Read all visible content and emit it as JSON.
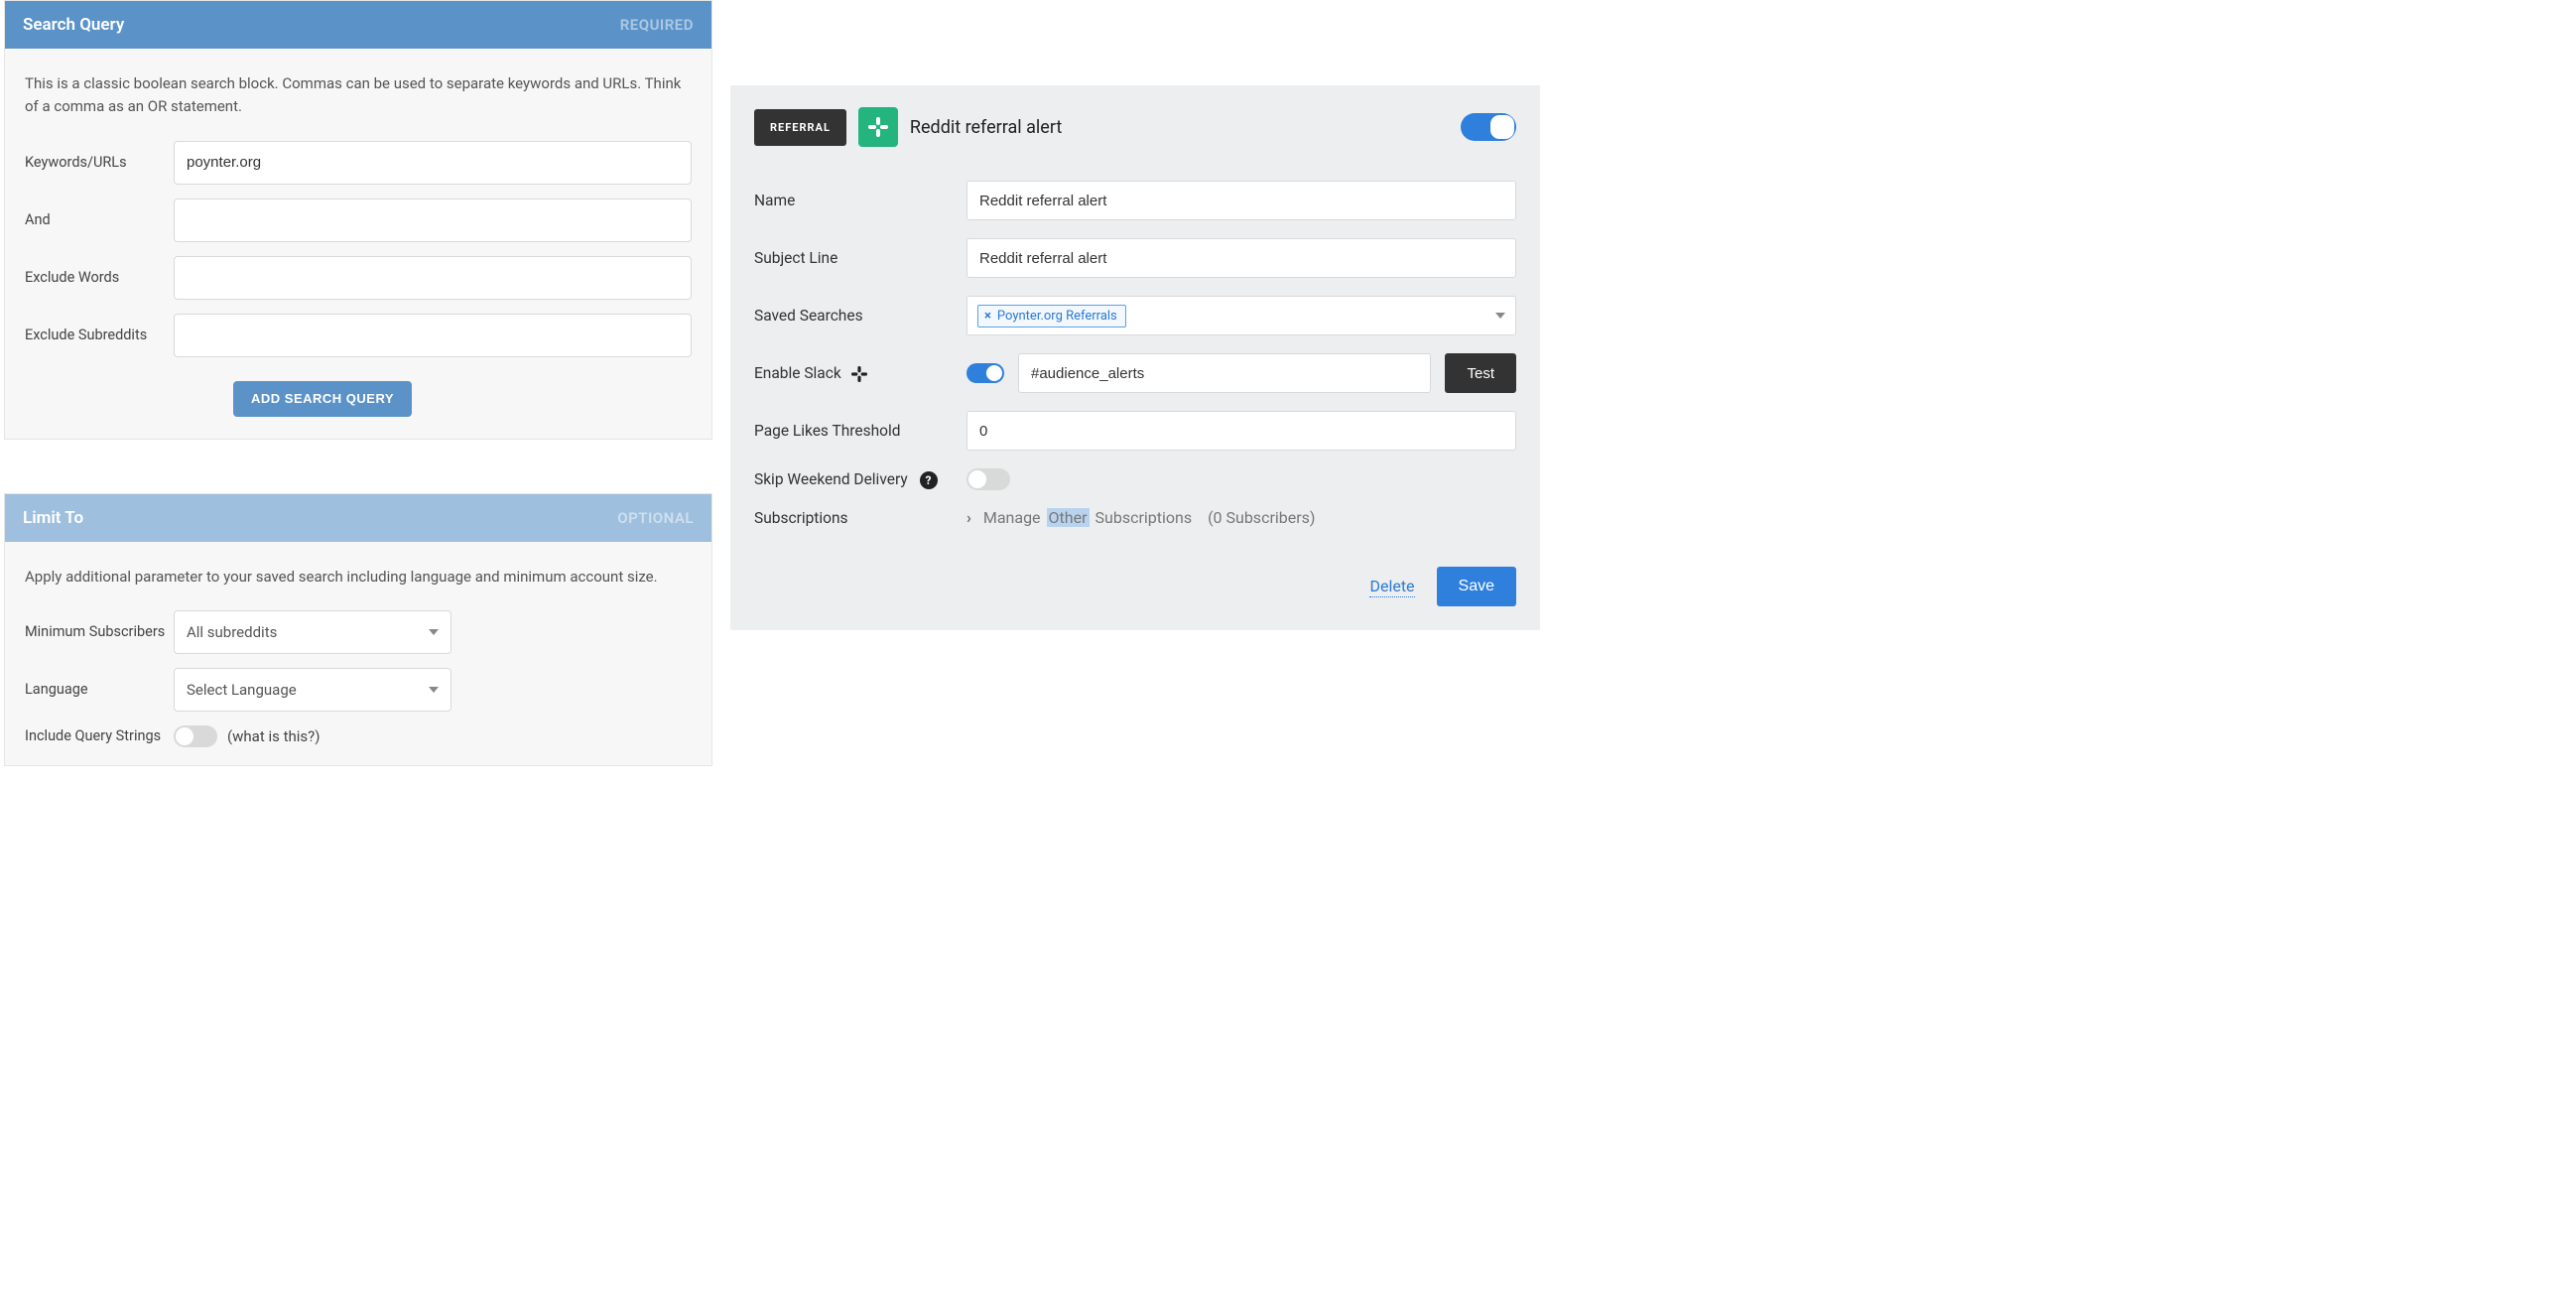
{
  "search": {
    "header": "Search Query",
    "tag": "REQUIRED",
    "desc": "This is a classic boolean search block. Commas can be used to separate keywords and URLs. Think of a comma as an OR statement.",
    "labels": {
      "keywords": "Keywords/URLs",
      "and": "And",
      "exclude_words": "Exclude Words",
      "exclude_subs": "Exclude Subreddits"
    },
    "values": {
      "keywords": "poynter.org",
      "and": "",
      "exclude_words": "",
      "exclude_subs": ""
    },
    "add_btn": "ADD SEARCH QUERY"
  },
  "limit": {
    "header": "Limit To",
    "tag": "OPTIONAL",
    "desc": "Apply additional parameter to your saved search including language and minimum account size.",
    "labels": {
      "min_subs": "Minimum Subscribers",
      "lang": "Language",
      "include_qs": "Include Query Strings"
    },
    "min_subs_value": "All subreddits",
    "lang_value": "Select Language",
    "whatis": "(what is this?)"
  },
  "alert": {
    "badge": "REFERRAL",
    "title": "Reddit referral alert",
    "labels": {
      "name": "Name",
      "subject": "Subject Line",
      "saved": "Saved Searches",
      "enable_slack": "Enable Slack",
      "threshold": "Page Likes Threshold",
      "skip_weekend": "Skip Weekend Delivery",
      "subscriptions": "Subscriptions"
    },
    "name_value": "Reddit referral alert",
    "subject_value": "Reddit referral alert",
    "chip": "Poynter.org Referrals",
    "slack_channel": "#audience_alerts",
    "test_btn": "Test",
    "threshold_value": "0",
    "subs_text_pre": "Manage",
    "subs_text_hl": "Other",
    "subs_text_post": "Subscriptions",
    "subs_count": "(0 Subscribers)",
    "delete": "Delete",
    "save": "Save"
  }
}
